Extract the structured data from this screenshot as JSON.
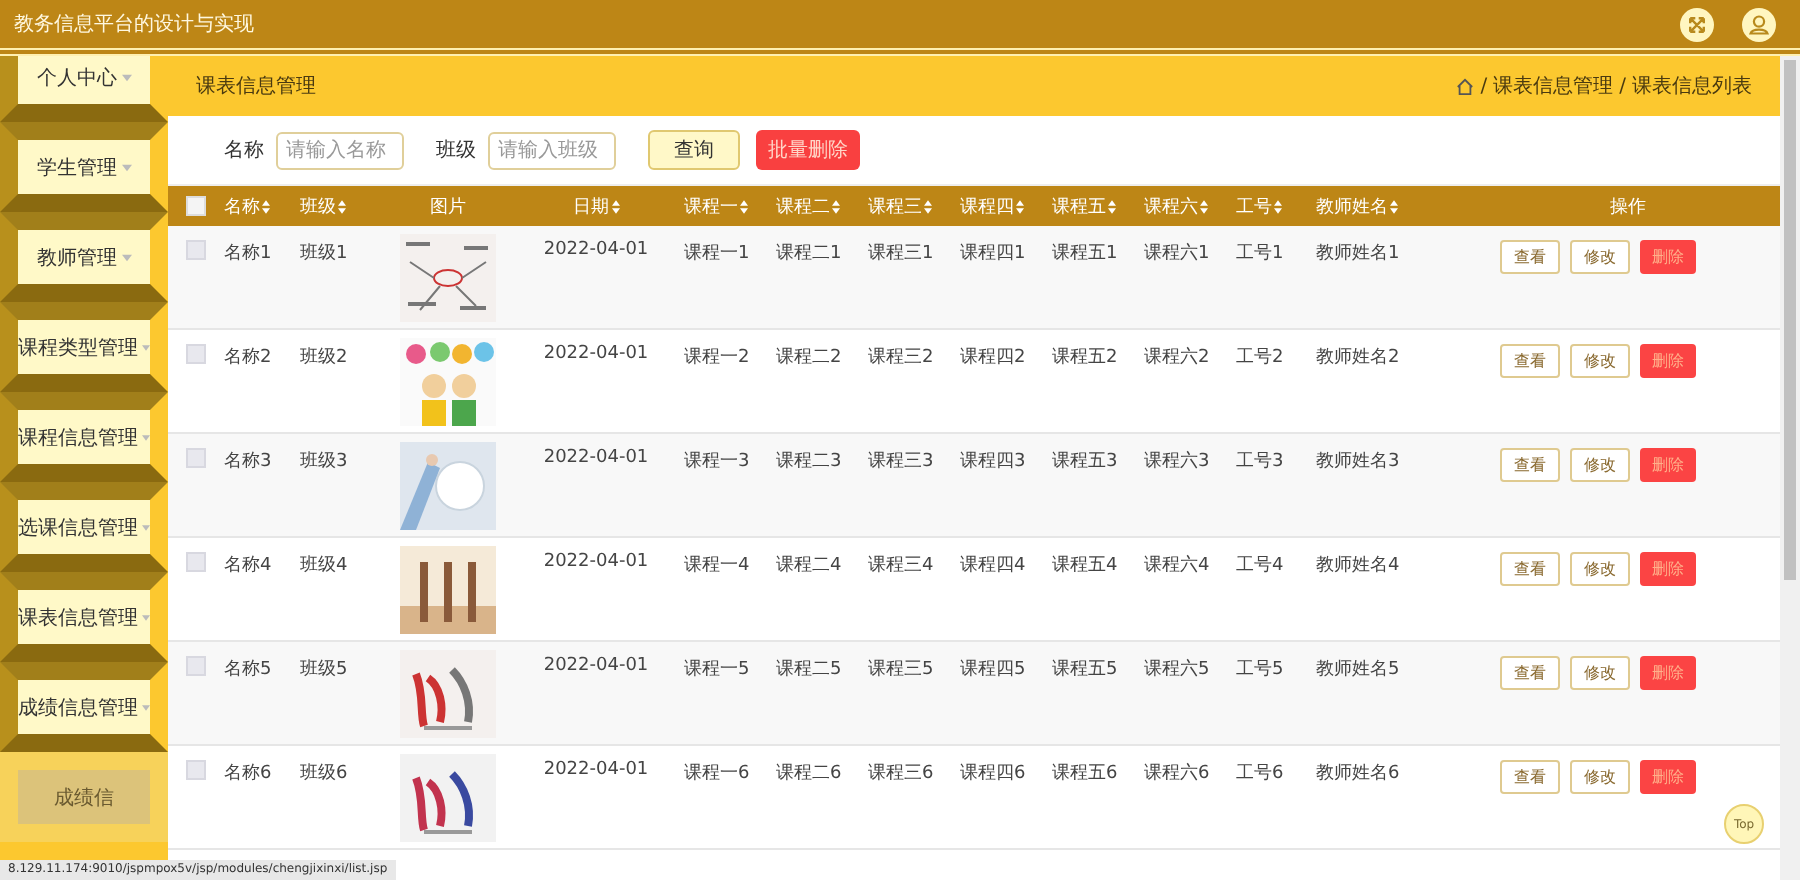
{
  "header": {
    "title": "教务信息平台的设计与实现"
  },
  "sidebar": {
    "items": [
      {
        "label": "个人中心",
        "selected": false
      },
      {
        "label": "学生管理",
        "selected": false
      },
      {
        "label": "教师管理",
        "selected": false
      },
      {
        "label": "课程类型管理",
        "selected": false
      },
      {
        "label": "课程信息管理",
        "selected": false
      },
      {
        "label": "选课信息管理",
        "selected": false
      },
      {
        "label": "课表信息管理",
        "selected": false
      },
      {
        "label": "成绩信息管理",
        "selected": false
      },
      {
        "label": "成绩信",
        "selected": true
      }
    ]
  },
  "page_title": "课表信息管理",
  "breadcrumb": [
    {
      "separator": "/",
      "label": "课表信息管理"
    },
    {
      "separator": "/",
      "label": "课表信息列表"
    }
  ],
  "search": {
    "fields": [
      {
        "label": "名称",
        "placeholder": "请输入名称"
      },
      {
        "label": "班级",
        "placeholder": "请输入班级"
      }
    ],
    "query_button": "查询",
    "delete_button": "批量删除"
  },
  "table": {
    "select_all": {
      "checked": false
    },
    "columns": [
      {
        "label": "名称",
        "kind": "text",
        "sortable": true
      },
      {
        "label": "班级",
        "kind": "text",
        "sortable": true
      },
      {
        "label": "图片",
        "kind": "picture",
        "sortable": false
      },
      {
        "label": "日期",
        "kind": "text",
        "sortable": true
      },
      {
        "label": "课程一",
        "kind": "text",
        "sortable": true
      },
      {
        "label": "课程二",
        "kind": "text",
        "sortable": true
      },
      {
        "label": "课程三",
        "kind": "text",
        "sortable": true
      },
      {
        "label": "课程四",
        "kind": "text",
        "sortable": true
      },
      {
        "label": "课程五",
        "kind": "text",
        "sortable": true
      },
      {
        "label": "课程六",
        "kind": "text",
        "sortable": true
      },
      {
        "label": "工号",
        "kind": "text",
        "sortable": true
      },
      {
        "label": "教师姓名",
        "kind": "text",
        "sortable": true
      },
      {
        "label": "操作",
        "kind": "actions",
        "sortable": false
      }
    ],
    "rows": [
      {
        "checked": false,
        "cells": [
          "名称1",
          "班级1",
          "",
          "2022-04-01",
          "课程一1",
          "课程二1",
          "课程三1",
          "课程四1",
          "课程五1",
          "课程六1",
          "工号1",
          "教师姓名1"
        ],
        "actions": [
          {
            "label": "查看",
            "kind": "view"
          },
          {
            "label": "修改",
            "kind": "edit"
          },
          {
            "label": "删除",
            "kind": "delete"
          }
        ]
      },
      {
        "checked": false,
        "cells": [
          "名称2",
          "班级2",
          "",
          "2022-04-01",
          "课程一2",
          "课程二2",
          "课程三2",
          "课程四2",
          "课程五2",
          "课程六2",
          "工号2",
          "教师姓名2"
        ],
        "actions": [
          {
            "label": "查看",
            "kind": "view"
          },
          {
            "label": "修改",
            "kind": "edit"
          },
          {
            "label": "删除",
            "kind": "delete"
          }
        ]
      },
      {
        "checked": false,
        "cells": [
          "名称3",
          "班级3",
          "",
          "2022-04-01",
          "课程一3",
          "课程二3",
          "课程三3",
          "课程四3",
          "课程五3",
          "课程六3",
          "工号3",
          "教师姓名3"
        ],
        "actions": [
          {
            "label": "查看",
            "kind": "view"
          },
          {
            "label": "修改",
            "kind": "edit"
          },
          {
            "label": "删除",
            "kind": "delete"
          }
        ]
      },
      {
        "checked": false,
        "cells": [
          "名称4",
          "班级4",
          "",
          "2022-04-01",
          "课程一4",
          "课程二4",
          "课程三4",
          "课程四4",
          "课程五4",
          "课程六4",
          "工号4",
          "教师姓名4"
        ],
        "actions": [
          {
            "label": "查看",
            "kind": "view"
          },
          {
            "label": "修改",
            "kind": "edit"
          },
          {
            "label": "删除",
            "kind": "delete"
          }
        ]
      },
      {
        "checked": false,
        "cells": [
          "名称5",
          "班级5",
          "",
          "2022-04-01",
          "课程一5",
          "课程二5",
          "课程三5",
          "课程四5",
          "课程五5",
          "课程六5",
          "工号5",
          "教师姓名5"
        ],
        "actions": [
          {
            "label": "查看",
            "kind": "view"
          },
          {
            "label": "修改",
            "kind": "edit"
          },
          {
            "label": "删除",
            "kind": "delete"
          }
        ]
      },
      {
        "checked": false,
        "cells": [
          "名称6",
          "班级6",
          "",
          "2022-04-01",
          "课程一6",
          "课程二6",
          "课程三6",
          "课程四6",
          "课程五6",
          "课程六6",
          "工号6",
          "教师姓名6"
        ],
        "actions": [
          {
            "label": "查看",
            "kind": "view"
          },
          {
            "label": "修改",
            "kind": "edit"
          },
          {
            "label": "删除",
            "kind": "delete"
          }
        ]
      }
    ]
  },
  "top_button": "Top",
  "status_bar": "8.129.11.174:9010/jspmpox5v/jsp/modules/chengjixinxi/list.jsp"
}
